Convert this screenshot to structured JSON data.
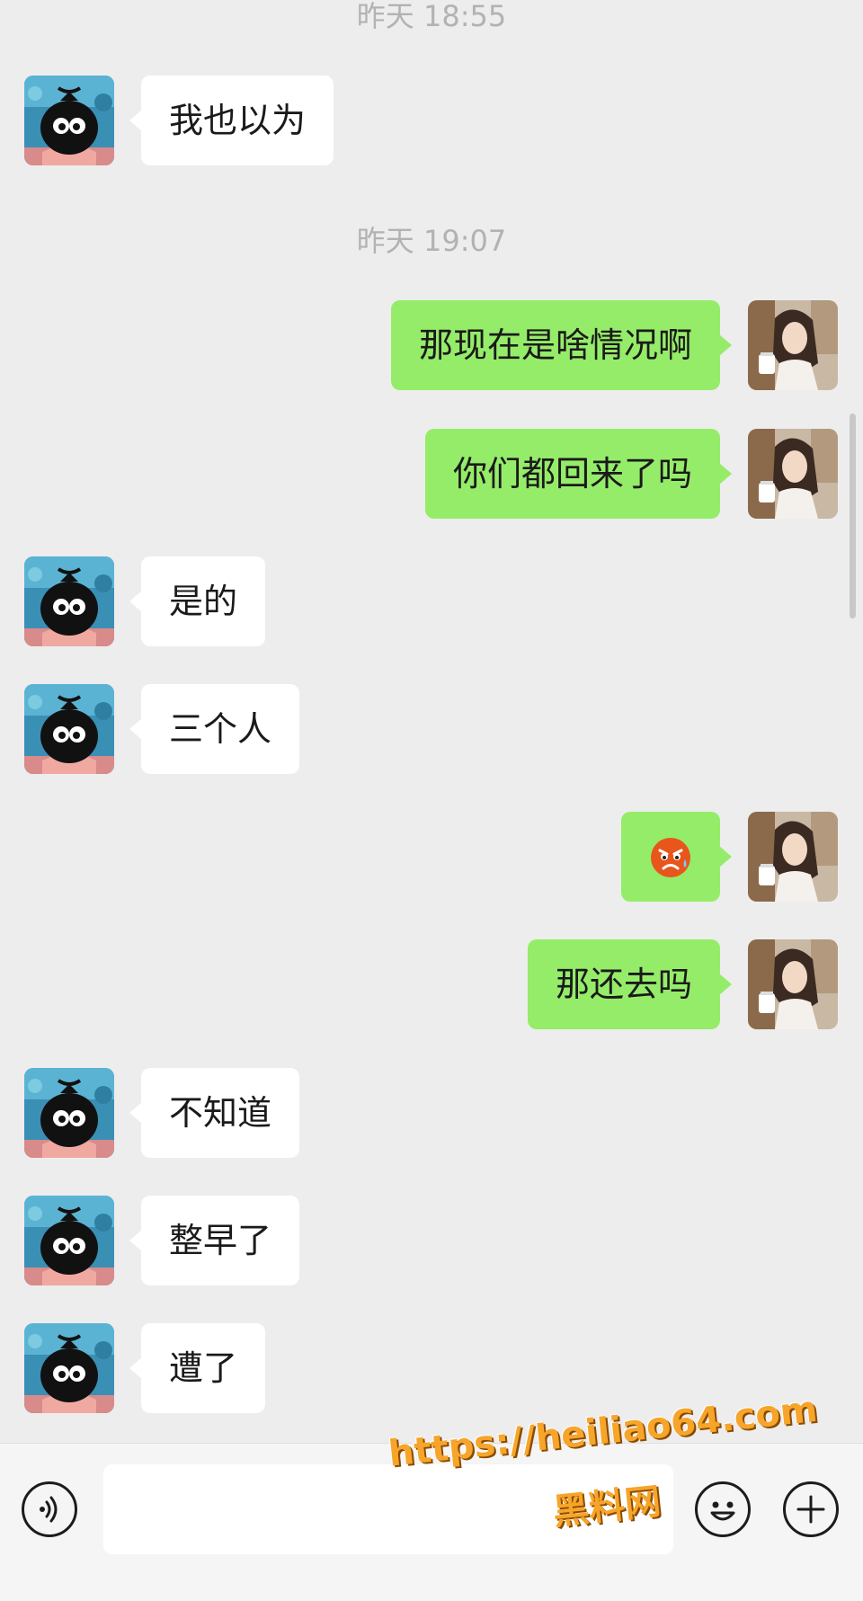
{
  "timestamps": {
    "t1": "昨天 18:55",
    "t2": "昨天 19:07"
  },
  "messages": [
    {
      "side": "in",
      "text": "我也以为"
    },
    {
      "side": "out",
      "text": "那现在是啥情况啊"
    },
    {
      "side": "out",
      "text": "你们都回来了吗"
    },
    {
      "side": "in",
      "text": "是的"
    },
    {
      "side": "in",
      "text": "三个人"
    },
    {
      "side": "out",
      "emoji": "angry-sweat-emoji"
    },
    {
      "side": "out",
      "text": "那还去吗"
    },
    {
      "side": "in",
      "text": "不知道"
    },
    {
      "side": "in",
      "text": "整早了"
    },
    {
      "side": "in",
      "text": "遭了"
    }
  ],
  "input": {
    "value": "",
    "placeholder": ""
  },
  "icons": {
    "voice": "voice-icon",
    "emoji": "emoji-icon",
    "plus": "plus-icon"
  },
  "watermark": {
    "url": "https://heiliao64.com",
    "name": "黑料网"
  },
  "colors": {
    "sent_bubble": "#95ec69",
    "received_bubble": "#ffffff",
    "background": "#ededed",
    "watermark": "#f7a52a"
  }
}
